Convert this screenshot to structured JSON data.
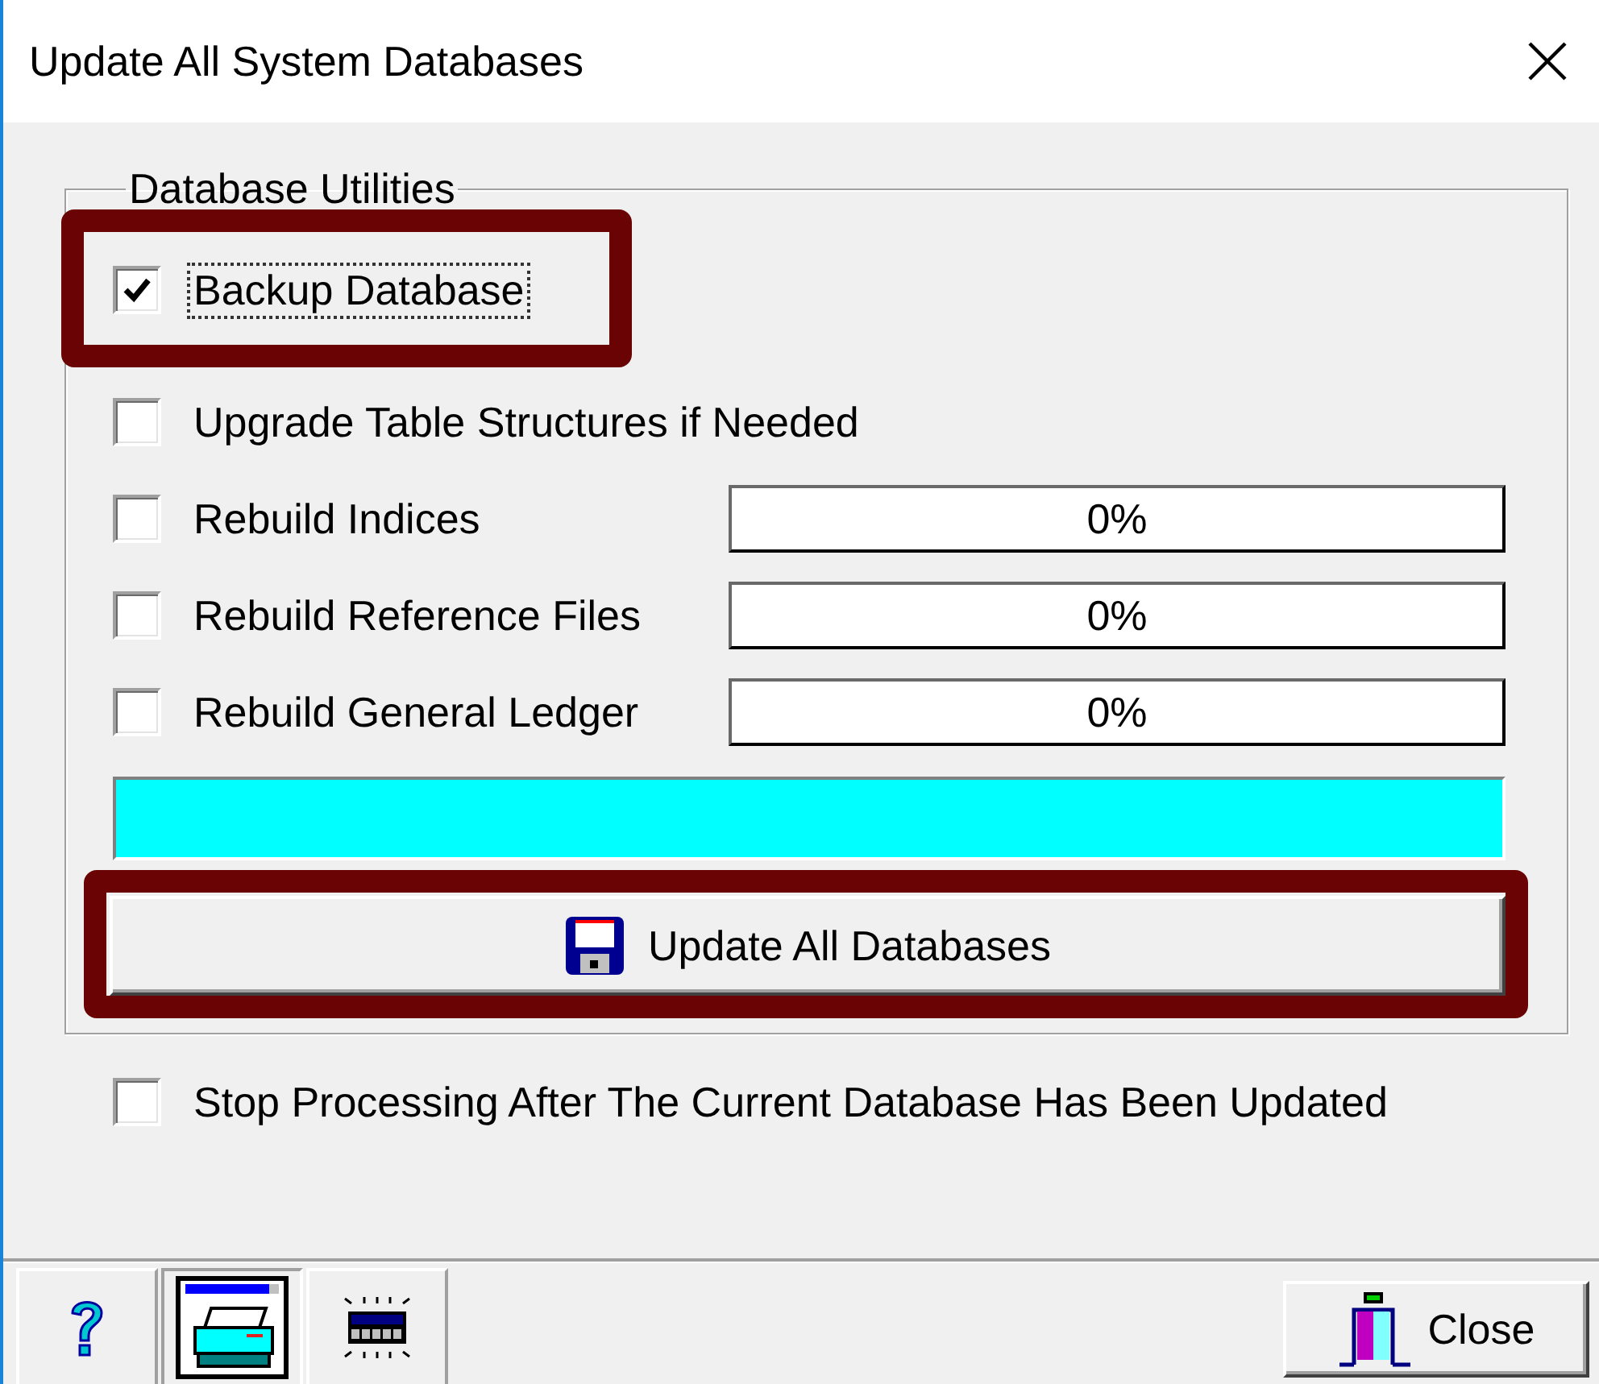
{
  "window": {
    "title": "Update All System Databases"
  },
  "group": {
    "title": "Database Utilities"
  },
  "options": [
    {
      "label": "Backup Database",
      "checked": true,
      "focused": true,
      "highlighted": true
    },
    {
      "label": "Upgrade Table Structures if Needed",
      "checked": false,
      "focused": false,
      "highlighted": false
    },
    {
      "label": "Rebuild Indices",
      "checked": false,
      "focused": false,
      "highlighted": false,
      "progress": {
        "level": 0,
        "reading": "0%"
      }
    },
    {
      "label": "Rebuild Reference Files",
      "checked": false,
      "focused": false,
      "highlighted": false,
      "progress": {
        "level": 0,
        "reading": "0%"
      }
    },
    {
      "label": "Rebuild General Ledger",
      "checked": false,
      "focused": false,
      "highlighted": false,
      "progress": {
        "level": 0,
        "reading": "0%"
      }
    }
  ],
  "overall_progress": {
    "level": 1
  },
  "update_button": {
    "label": "Update All Databases",
    "highlighted": true
  },
  "stop_option": {
    "label": "Stop Processing After The Current Database Has Been Updated",
    "checked": false
  },
  "toolbar": [
    {
      "kind": "help",
      "pressed": false
    },
    {
      "kind": "print",
      "pressed": true
    },
    {
      "kind": "device",
      "pressed": false
    }
  ],
  "close_button": {
    "label": "Close"
  }
}
